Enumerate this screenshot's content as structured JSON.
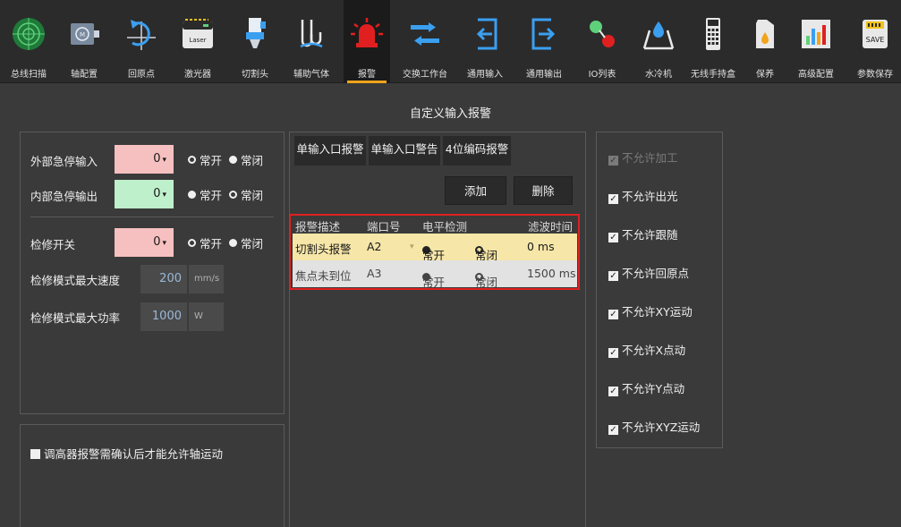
{
  "toolbar": {
    "items": [
      {
        "label": "总线扫描",
        "icon": "radar-icon"
      },
      {
        "label": "轴配置",
        "icon": "motor-icon"
      },
      {
        "label": "回原点",
        "icon": "return-origin-icon"
      },
      {
        "label": "激光器",
        "icon": "laser-icon",
        "icon_text": "Laser"
      },
      {
        "label": "切割头",
        "icon": "cutting-head-icon"
      },
      {
        "label": "辅助气体",
        "icon": "gas-icon"
      },
      {
        "label": "报警",
        "icon": "alarm-light-icon"
      },
      {
        "label": "交换工作台",
        "icon": "exchange-table-icon"
      },
      {
        "label": "通用输入",
        "icon": "input-icon"
      },
      {
        "label": "通用输出",
        "icon": "output-icon"
      },
      {
        "label": "IO列表",
        "icon": "io-list-icon"
      },
      {
        "label": "水冷机",
        "icon": "water-cooler-icon"
      },
      {
        "label": "无线手持盒",
        "icon": "remote-icon"
      },
      {
        "label": "保养",
        "icon": "oil-can-icon"
      },
      {
        "label": "高级配置",
        "icon": "bar-chart-icon"
      },
      {
        "label": "参数保存",
        "icon": "save-icon",
        "icon_text": "SAVE"
      }
    ],
    "active_index": 6
  },
  "section_title": "自定义输入报警",
  "left_panel": {
    "external_estop": {
      "label": "外部急停输入",
      "value": "0",
      "opt1": "常开",
      "opt2": "常闭"
    },
    "internal_estop": {
      "label": "内部急停输出",
      "value": "0",
      "opt1": "常开",
      "opt2": "常闭"
    },
    "maintenance_switch": {
      "label": "检修开关",
      "value": "0",
      "opt1": "常开",
      "opt2": "常闭"
    },
    "max_speed": {
      "label": "检修模式最大速度",
      "value": "200",
      "unit": "mm/s"
    },
    "max_power": {
      "label": "检修模式最大功率",
      "value": "1000",
      "unit": "W"
    }
  },
  "bottom_left": {
    "checkbox_label": "调高器报警需确认后才能允许轴运动"
  },
  "center": {
    "tabs": [
      "单输入口报警",
      "单输入口警告",
      "4位编码报警"
    ],
    "add_button": "添加",
    "delete_button": "删除",
    "headers": [
      "报警描述",
      "端口号",
      "电平检测",
      "滤波时间"
    ],
    "rows": [
      {
        "desc": "切割头报警",
        "port": "A2",
        "opt1": "常开",
        "opt2": "常闭",
        "filter": "0 ms"
      },
      {
        "desc": "焦点未到位",
        "port": "A3",
        "opt1": "常开",
        "opt2": "常闭",
        "filter": "1500 ms"
      }
    ]
  },
  "right_panel": {
    "options": [
      {
        "label": "不允许加工",
        "checked": true,
        "disabled": true
      },
      {
        "label": "不允许出光",
        "checked": true,
        "disabled": false
      },
      {
        "label": "不允许跟随",
        "checked": true,
        "disabled": false
      },
      {
        "label": "不允许回原点",
        "checked": true,
        "disabled": false
      },
      {
        "label": "不允许XY运动",
        "checked": true,
        "disabled": false
      },
      {
        "label": "不允许X点动",
        "checked": true,
        "disabled": false
      },
      {
        "label": "不允许Y点动",
        "checked": true,
        "disabled": false
      },
      {
        "label": "不允许XYZ运动",
        "checked": true,
        "disabled": false
      }
    ]
  },
  "colors": {
    "accent": "#f2a31b",
    "alarm_red": "#e02020",
    "highlight_row": "#f6e6a8",
    "pink_input": "#f7c0c0",
    "green_input": "#bff0cc"
  }
}
